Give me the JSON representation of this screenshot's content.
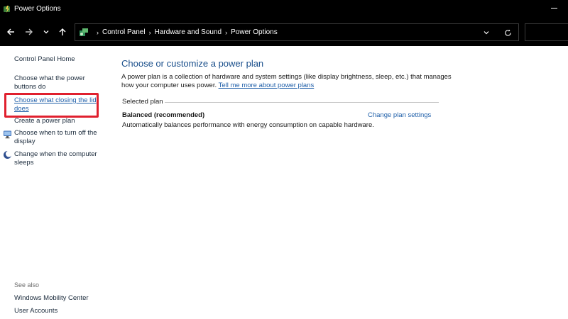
{
  "window": {
    "title": "Power Options",
    "app_icon": "power-options-icon"
  },
  "address_bar": {
    "breadcrumbs": [
      "Control Panel",
      "Hardware and Sound",
      "Power Options"
    ],
    "icon": "control-panel-icon"
  },
  "sidebar": {
    "home": "Control Panel Home",
    "items": [
      {
        "label": "Choose what the power buttons do",
        "icon": ""
      },
      {
        "label": "Choose what closing the lid does",
        "icon": "",
        "highlighted": true
      },
      {
        "label": "Create a power plan",
        "icon": ""
      },
      {
        "label": "Choose when to turn off the display",
        "icon": "monitor-icon"
      },
      {
        "label": "Change when the computer sleeps",
        "icon": "moon-icon"
      }
    ],
    "see_also": {
      "heading": "See also",
      "links": [
        "Windows Mobility Center",
        "User Accounts"
      ]
    }
  },
  "main": {
    "title": "Choose or customize a power plan",
    "intro": "A power plan is a collection of hardware and system settings (like display brightness, sleep, etc.) that manages how your computer uses power.",
    "intro_link": "Tell me more about power plans",
    "section_label": "Selected plan",
    "plan": {
      "name": "Balanced (recommended)",
      "settings_link": "Change plan settings",
      "description": "Automatically balances performance with energy consumption on capable hardware."
    }
  },
  "colors": {
    "highlight_box": "#e0202e",
    "link": "#1f5fa9",
    "title": "#1a4f8b"
  }
}
